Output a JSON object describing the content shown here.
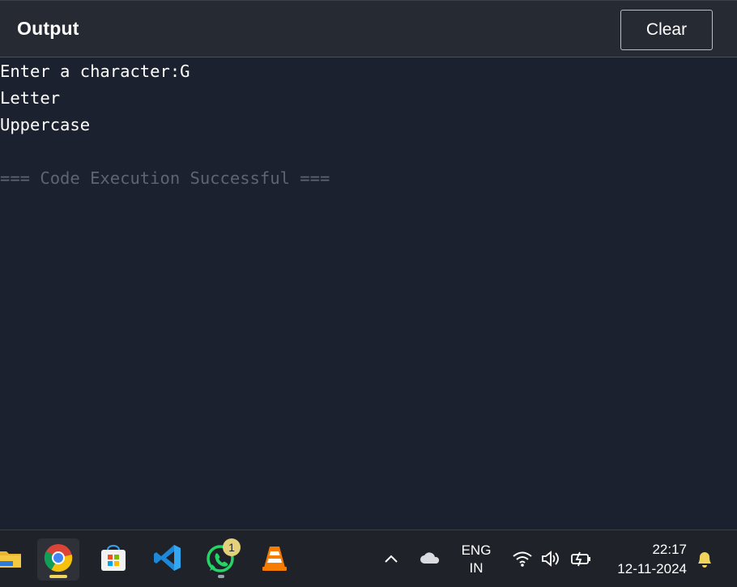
{
  "header": {
    "title": "Output",
    "clear_label": "Clear"
  },
  "output": {
    "lines": [
      "Enter a character:G",
      "Letter",
      "Uppercase",
      "",
      "=== Code Execution Successful ==="
    ]
  },
  "taskbar": {
    "apps": [
      {
        "name": "file-explorer-icon"
      },
      {
        "name": "chrome-icon",
        "active": true
      },
      {
        "name": "microsoft-store-icon"
      },
      {
        "name": "vscode-icon"
      },
      {
        "name": "whatsapp-icon",
        "badge": "1"
      },
      {
        "name": "vlc-icon"
      }
    ],
    "tray": {
      "language": "ENG",
      "region": "IN",
      "time": "22:17",
      "date": "12-11-2024"
    }
  },
  "colors": {
    "background": "#1c2130",
    "header": "#262a33",
    "taskbar": "#1f2228",
    "muted_text": "#5f6470"
  }
}
